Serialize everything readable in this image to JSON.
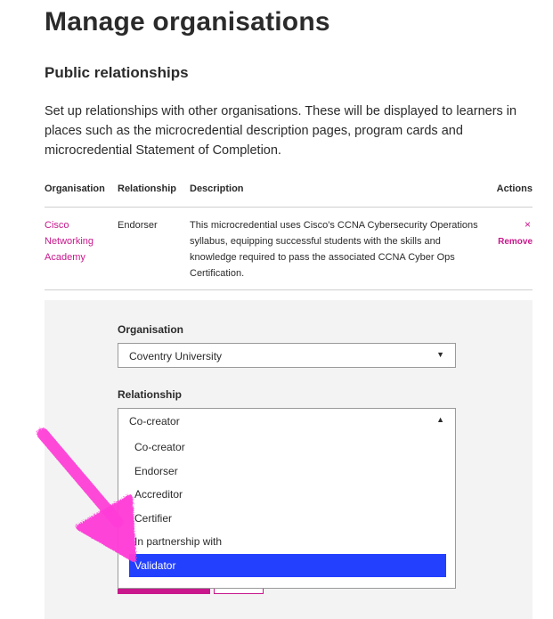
{
  "page": {
    "title": "Manage organisations",
    "section_title": "Public relationships",
    "intro": "Set up relationships with other organisations. These will be displayed to learners in places such as the microcredential description pages, program cards and microcredential Statement of Completion."
  },
  "table": {
    "headers": {
      "organisation": "Organisation",
      "relationship": "Relationship",
      "description": "Description",
      "actions": "Actions"
    },
    "rows": [
      {
        "organisation": "Cisco Networking Academy",
        "relationship": "Endorser",
        "description": "This microcredential uses Cisco's CCNA Cybersecurity Operations syllabus, equipping successful students with the skills and knowledge required to pass the associated CCNA Cyber Ops Certification.",
        "remove_icon": "×",
        "remove_label": "Remove"
      }
    ]
  },
  "form": {
    "organisation_label": "Organisation",
    "organisation_value": "Coventry University",
    "organisation_arrow": "▼",
    "relationship_label": "Relationship",
    "relationship_value": "Co-creator",
    "relationship_arrow": "▲",
    "relationship_options": [
      "Co-creator",
      "Endorser",
      "Accreditor",
      "Certifier",
      "In partnership with",
      "Validator"
    ],
    "highlighted_option": "Validator"
  },
  "colors": {
    "accent": "#c8188c",
    "selection": "#2340ff",
    "annotation_arrow": "#ff3ad6"
  },
  "icons": {
    "dropdown_closed": "chevron-down-icon",
    "dropdown_open": "chevron-up-icon",
    "remove": "close-icon",
    "annotation": "pointer-arrow-icon"
  }
}
